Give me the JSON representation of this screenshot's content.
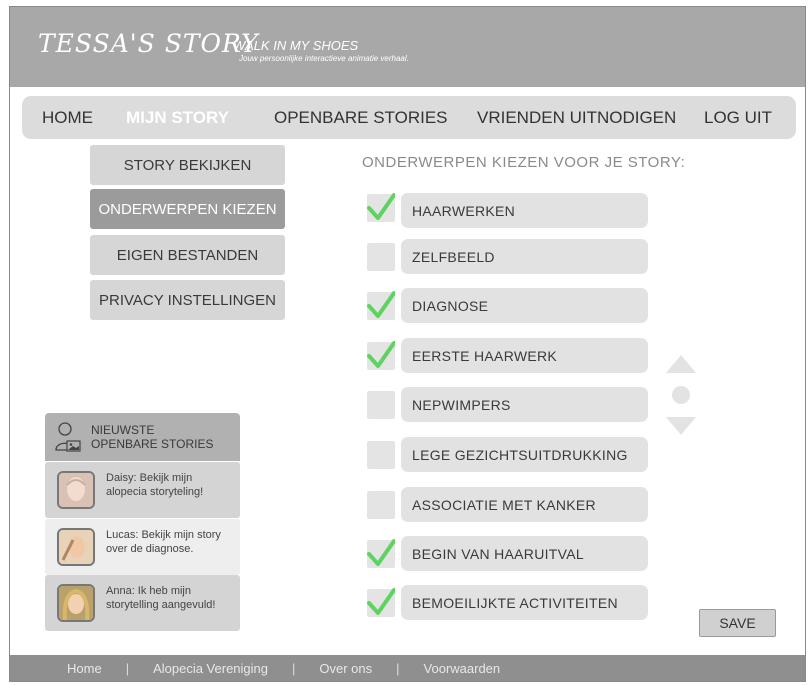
{
  "header": {
    "brand": "TESSA'S STORY",
    "tagline": "WALK IN MY SHOES",
    "subtagline": "Jouw persoonlijke interactieve animatie verhaal."
  },
  "nav": {
    "items": [
      {
        "label": "HOME",
        "active": false
      },
      {
        "label": "MIJN STORY",
        "active": true
      },
      {
        "label": "OPENBARE STORIES",
        "active": false
      },
      {
        "label": "VRIENDEN UITNODIGEN",
        "active": false
      },
      {
        "label": "LOG UIT",
        "active": false
      }
    ]
  },
  "submenu": {
    "items": [
      {
        "label": "STORY BEKIJKEN",
        "active": false
      },
      {
        "label": "ONDERWERPEN KIEZEN",
        "active": true
      },
      {
        "label": "EIGEN BESTANDEN",
        "active": false
      },
      {
        "label": "PRIVACY INSTELLINGEN",
        "active": false
      }
    ]
  },
  "stories": {
    "title_line1": "NIEUWSTE",
    "title_line2": "OPENBARE STORIES",
    "icon": "user-image-icon",
    "items": [
      {
        "text": "Daisy: Bekijk mijn alopecia storyteling!",
        "bg": "#d4d4d4"
      },
      {
        "text": "Lucas: Bekijk mijn story over de diagnose.",
        "bg": "#eeeeee"
      },
      {
        "text": "Anna: Ik heb mijn storytelling aangevuld!",
        "bg": "#d4d4d4"
      }
    ]
  },
  "topics": {
    "title": "ONDERWERPEN KIEZEN VOOR JE STORY:",
    "check_color": "#5fd35f",
    "items": [
      {
        "label": "HAARWERKEN",
        "checked": true
      },
      {
        "label": "ZELFBEELD",
        "checked": false
      },
      {
        "label": "DIAGNOSE",
        "checked": true
      },
      {
        "label": "EERSTE HAARWERK",
        "checked": true
      },
      {
        "label": "NEPWIMPERS",
        "checked": false
      },
      {
        "label": "LEGE GEZICHTSUITDRUKKING",
        "checked": false
      },
      {
        "label": "ASSOCIATIE MET KANKER",
        "checked": false
      },
      {
        "label": "BEGIN VAN HAARUITVAL",
        "checked": true
      },
      {
        "label": "BEMOEILIJKTE ACTIVITEITEN",
        "checked": true
      }
    ]
  },
  "save_label": "SAVE",
  "footer": {
    "links": [
      "Home",
      "Alopecia Vereniging",
      "Over ons",
      "Voorwaarden"
    ],
    "separator": "|"
  }
}
